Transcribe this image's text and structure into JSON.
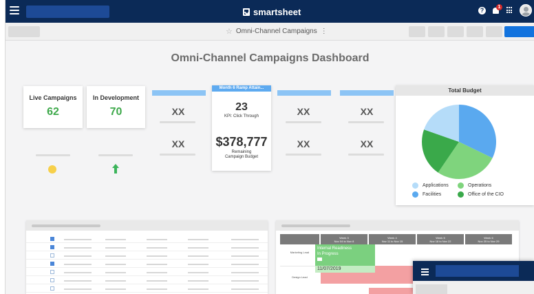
{
  "app": {
    "brand": "smartsheet",
    "notification_count": "1"
  },
  "toolbar": {
    "sheet_title": "Omni-Channel Campaigns"
  },
  "dashboard": {
    "title": "Omni-Channel Campaigns Dashboard",
    "metrics": [
      {
        "label": "Live Campaigns",
        "value": "62"
      },
      {
        "label": "In Development",
        "value": "70"
      }
    ],
    "placeholders": [
      "XX",
      "XX",
      "XX",
      "XX",
      "XX",
      "XX"
    ],
    "kpi": {
      "header": "Month 6 Ramp Attain...",
      "value": "23",
      "label": "KPI: Click Through",
      "money": "$378,777",
      "money_label_1": "Remaining",
      "money_label_2": "Campaign Budget"
    },
    "budget": {
      "title": "Total Budget",
      "legend": [
        {
          "name": "Applications",
          "color": "#b5dcf9"
        },
        {
          "name": "Operations",
          "color": "#7fd47d"
        },
        {
          "name": "Facilities",
          "color": "#5aa9ef"
        },
        {
          "name": "Office of the CIO",
          "color": "#3aa94a"
        }
      ]
    }
  },
  "gantt": {
    "weeks": [
      {
        "w": "Week 3",
        "d": "Nov 04 to Nov 8"
      },
      {
        "w": "Week 4",
        "d": "Nov 11 to Nov 15"
      },
      {
        "w": "Week 5",
        "d": "Nov 18 to Nov 22"
      },
      {
        "w": "Week 6",
        "d": "Nov 25 to Nov 29"
      }
    ],
    "rows": [
      "Marketing Lead",
      "Design Lead"
    ],
    "task": {
      "title": "Internal Readiness",
      "status": "In Progress",
      "date": "11/07/2019"
    }
  },
  "colors": {
    "nav": "#0b2a57",
    "accent": "#1273de",
    "success": "#3ea94b"
  }
}
